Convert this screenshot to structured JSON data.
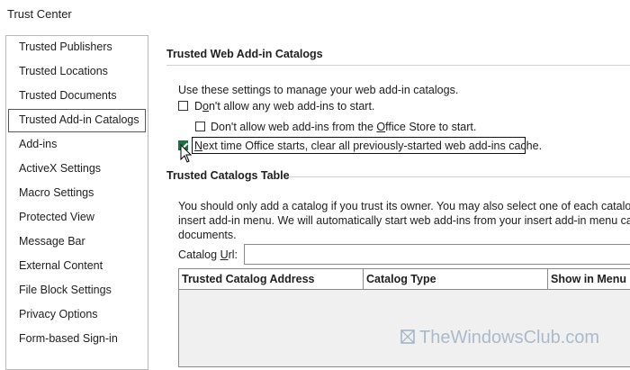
{
  "window": {
    "title": "Trust Center"
  },
  "sidebar": {
    "items": [
      {
        "label": "Trusted Publishers"
      },
      {
        "label": "Trusted Locations"
      },
      {
        "label": "Trusted Documents"
      },
      {
        "label": "Trusted Add-in Catalogs",
        "selected": true
      },
      {
        "label": "Add-ins"
      },
      {
        "label": "ActiveX Settings"
      },
      {
        "label": "Macro Settings"
      },
      {
        "label": "Protected View"
      },
      {
        "label": "Message Bar"
      },
      {
        "label": "External Content"
      },
      {
        "label": "File Block Settings"
      },
      {
        "label": "Privacy Options"
      },
      {
        "label": "Form-based Sign-in"
      }
    ]
  },
  "web_addins": {
    "section_title": "Trusted Web Add-in Catalogs",
    "intro": "Use these settings to manage your web add-in catalogs.",
    "opt1": {
      "label_pre": "D",
      "label_acc": "o",
      "label_post": "n't allow any web add-ins to start.",
      "checked": false
    },
    "opt2": {
      "label_pre": "Don't allow web add-ins from the ",
      "label_acc": "O",
      "label_post": "ffice Store to start.",
      "checked": false
    },
    "opt3": {
      "label_pre": "",
      "label_acc": "N",
      "label_post": "ext time Office starts, clear all previously-started web add-ins cache.",
      "checked": true
    }
  },
  "catalogs": {
    "section_title": "Trusted Catalogs Table",
    "description_line1": "You should only add a catalog if you trust its owner. You may also select one of each catalog type",
    "description_line2": "insert add-in menu. We will automatically start web add-ins from your insert add-in menu catalog",
    "description_line3": "documents.",
    "url_label_pre": "Catalog ",
    "url_label_acc": "U",
    "url_label_post": "rl:",
    "url_value": "",
    "columns": [
      "Trusted Catalog Address",
      "Catalog Type",
      "Show in Menu"
    ]
  },
  "watermark": {
    "text": "TheWindowsClub.com"
  },
  "colors": {
    "accent": "#1e7145",
    "border": "#8a8a8a"
  }
}
